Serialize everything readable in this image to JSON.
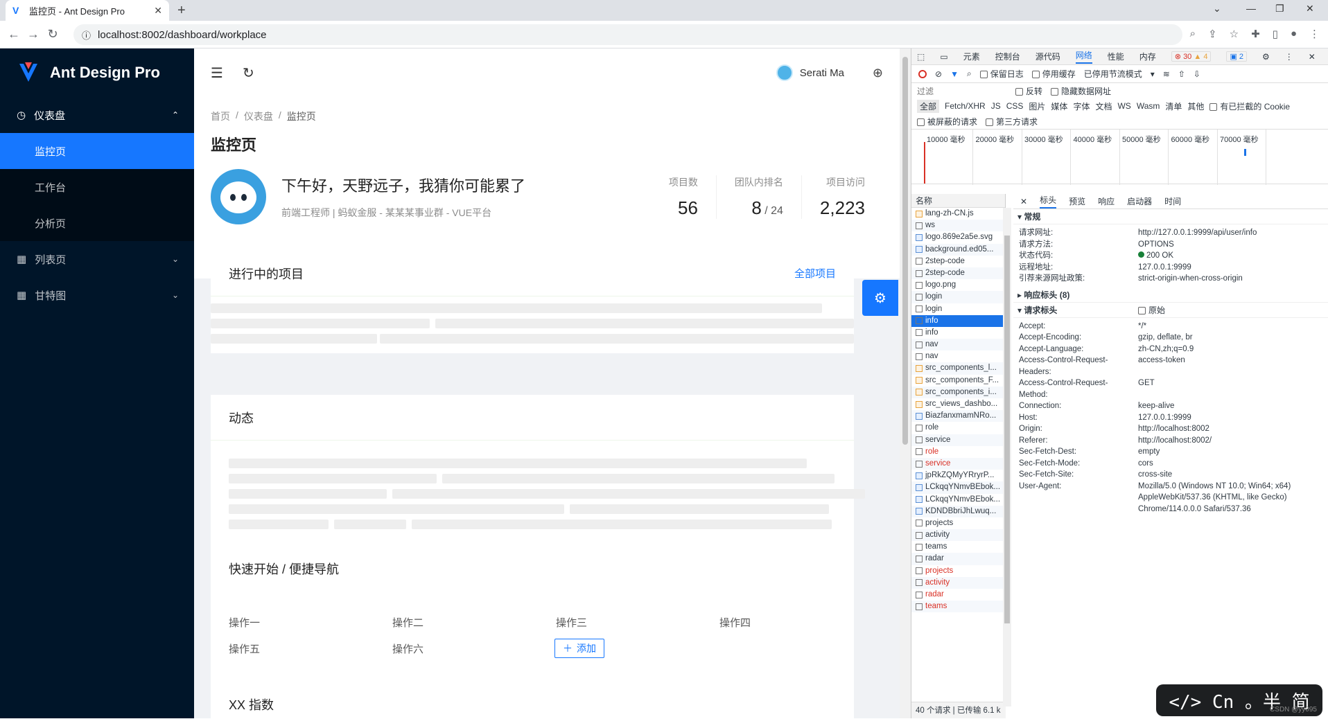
{
  "browser": {
    "tab_title": "监控页 - Ant Design Pro",
    "url": "localhost:8002/dashboard/workplace"
  },
  "sider": {
    "brand": "Ant Design Pro",
    "menu": [
      {
        "label": "仪表盘",
        "icon": "dashboard-icon"
      },
      {
        "label": "监控页"
      },
      {
        "label": "工作台"
      },
      {
        "label": "分析页"
      },
      {
        "label": "列表页",
        "icon": "table-icon"
      },
      {
        "label": "甘特图",
        "icon": "table-icon"
      }
    ]
  },
  "header": {
    "user": "Serati Ma"
  },
  "breadcrumb": [
    "首页",
    "/",
    "仪表盘",
    "/",
    "监控页"
  ],
  "page_title": "监控页",
  "greeting": "下午好，天野远子，我猜你可能累了",
  "subtitle": "前端工程师 | 蚂蚁金服 - 某某某事业群 - VUE平台",
  "stats": [
    {
      "label": "项目数",
      "value": "56"
    },
    {
      "label": "团队内排名",
      "value": "8",
      "total": " / 24"
    },
    {
      "label": "项目访问",
      "value": "2,223"
    }
  ],
  "cards": {
    "projects": {
      "title": "进行中的项目",
      "link": "全部项目"
    },
    "activity": {
      "title": "动态"
    },
    "quick": {
      "title": "快速开始 / 便捷导航",
      "items": [
        "操作一",
        "操作二",
        "操作三",
        "操作四",
        "操作五",
        "操作六"
      ],
      "add": "添加"
    },
    "index": {
      "title": "XX 指数"
    }
  },
  "devtools": {
    "tabs": [
      "元素",
      "控制台",
      "源代码",
      "网络",
      "性能",
      "内存"
    ],
    "errors": "30",
    "warnings": "4",
    "infos": "2",
    "toolbar": {
      "preserve_log": "保留日志",
      "disable_cache": "停用缓存",
      "throttle": "已停用节流模式"
    },
    "filter": {
      "placeholder": "过滤",
      "invert": "反转",
      "hide_data": "隐藏数据网址"
    },
    "types": [
      "全部",
      "Fetch/XHR",
      "JS",
      "CSS",
      "图片",
      "媒体",
      "字体",
      "文档",
      "WS",
      "Wasm",
      "清单",
      "其他"
    ],
    "blocked_cookies": "有已拦截的 Cookie",
    "blocked_requests": "被屏蔽的请求",
    "third_party": "第三方请求",
    "timeline": [
      "10000 毫秒",
      "20000 毫秒",
      "30000 毫秒",
      "40000 毫秒",
      "50000 毫秒",
      "60000 毫秒",
      "70000 毫秒"
    ],
    "name_header": "名称",
    "requests": [
      {
        "n": "lang-zh-CN.js",
        "t": "js"
      },
      {
        "n": "ws",
        "t": ""
      },
      {
        "n": "logo.869e2a5e.svg",
        "t": "img"
      },
      {
        "n": "background.ed05...",
        "t": "img"
      },
      {
        "n": "2step-code",
        "t": ""
      },
      {
        "n": "2step-code",
        "t": ""
      },
      {
        "n": "logo.png",
        "t": ""
      },
      {
        "n": "login",
        "t": ""
      },
      {
        "n": "login",
        "t": ""
      },
      {
        "n": "info",
        "t": "",
        "sel": true
      },
      {
        "n": "info",
        "t": ""
      },
      {
        "n": "nav",
        "t": ""
      },
      {
        "n": "nav",
        "t": ""
      },
      {
        "n": "src_components_l...",
        "t": "js"
      },
      {
        "n": "src_components_F...",
        "t": "js"
      },
      {
        "n": "src_components_i...",
        "t": "js"
      },
      {
        "n": "src_views_dashbo...",
        "t": "js"
      },
      {
        "n": "BiazfanxmamNRo...",
        "t": "img"
      },
      {
        "n": "role",
        "t": ""
      },
      {
        "n": "service",
        "t": ""
      },
      {
        "n": "role",
        "t": "",
        "err": true
      },
      {
        "n": "service",
        "t": "",
        "err": true
      },
      {
        "n": "jpRkZQMyYRryrP...",
        "t": "img"
      },
      {
        "n": "LCkqqYNmvBEbok...",
        "t": "img"
      },
      {
        "n": "LCkqqYNmvBEbok...",
        "t": "img"
      },
      {
        "n": "KDNDBbriJhLwuq...",
        "t": "img"
      },
      {
        "n": "projects",
        "t": ""
      },
      {
        "n": "activity",
        "t": ""
      },
      {
        "n": "teams",
        "t": ""
      },
      {
        "n": "radar",
        "t": ""
      },
      {
        "n": "projects",
        "t": "",
        "err": true
      },
      {
        "n": "activity",
        "t": "",
        "err": true
      },
      {
        "n": "radar",
        "t": "",
        "err": true
      },
      {
        "n": "teams",
        "t": "",
        "err": true
      }
    ],
    "footer": "40 个请求  |  已传输 6.1 k",
    "detail_tabs": [
      "标头",
      "预览",
      "响应",
      "启动器",
      "时间"
    ],
    "general_title": "常规",
    "general": [
      {
        "k": "请求网址:",
        "v": "http://127.0.0.1:9999/api/user/info"
      },
      {
        "k": "请求方法:",
        "v": "OPTIONS"
      },
      {
        "k": "状态代码:",
        "v": "200 OK",
        "status": true
      },
      {
        "k": "远程地址:",
        "v": "127.0.0.1:9999"
      },
      {
        "k": "引荐来源网址政策:",
        "v": "strict-origin-when-cross-origin"
      }
    ],
    "response_headers_title": "响应标头 (8)",
    "request_headers_title": "请求标头",
    "raw_label": "原始",
    "request_headers": [
      {
        "k": "Accept:",
        "v": "*/*"
      },
      {
        "k": "Accept-Encoding:",
        "v": "gzip, deflate, br"
      },
      {
        "k": "Accept-Language:",
        "v": "zh-CN,zh;q=0.9"
      },
      {
        "k": "Access-Control-Request-",
        "v": "access-token"
      },
      {
        "k": "Headers:",
        "v": ""
      },
      {
        "k": "Access-Control-Request-",
        "v": "GET"
      },
      {
        "k": "Method:",
        "v": ""
      },
      {
        "k": "Connection:",
        "v": "keep-alive"
      },
      {
        "k": "Host:",
        "v": "127.0.0.1:9999"
      },
      {
        "k": "Origin:",
        "v": "http://localhost:8002"
      },
      {
        "k": "Referer:",
        "v": "http://localhost:8002/"
      },
      {
        "k": "Sec-Fetch-Dest:",
        "v": "empty"
      },
      {
        "k": "Sec-Fetch-Mode:",
        "v": "cors"
      },
      {
        "k": "Sec-Fetch-Site:",
        "v": "cross-site"
      },
      {
        "k": "User-Agent:",
        "v": "Mozilla/5.0 (Windows NT 10.0; Win64; x64)"
      },
      {
        "k": "",
        "v": "AppleWebKit/537.36 (KHTML, like Gecko)"
      },
      {
        "k": "",
        "v": "Chrome/114.0.0.0 Safari/537.36"
      }
    ]
  },
  "watermark": {
    "text": "</> Cn 。半 简",
    "sub": "CSDN @yy095"
  },
  "colors": {
    "primary": "#1677ff",
    "sider": "#001529",
    "error": "#d93025"
  }
}
